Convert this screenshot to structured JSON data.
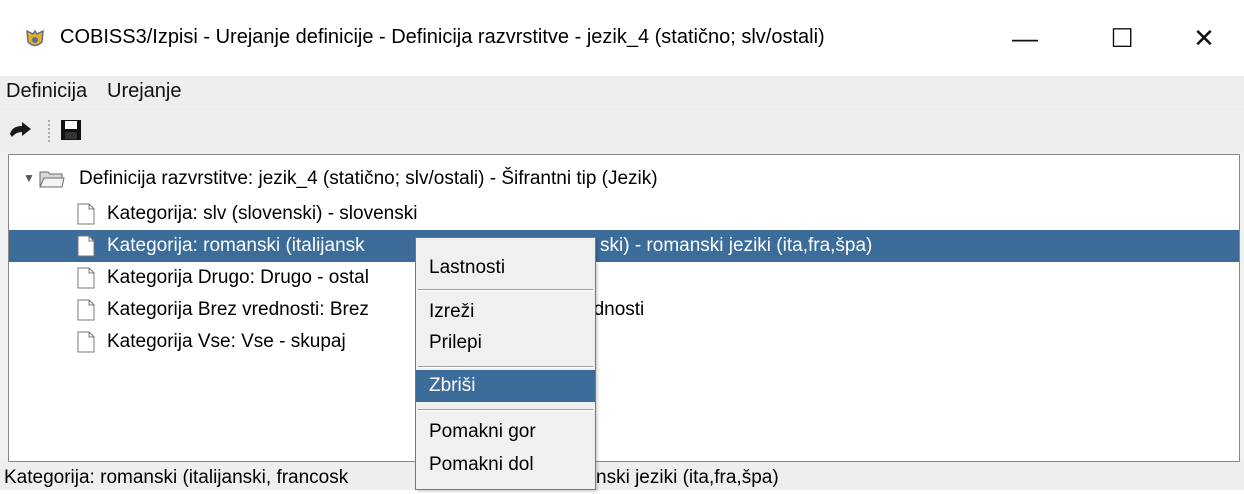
{
  "window": {
    "title": "COBISS3/Izpisi - Urejanje definicije - Definicija razvrstitve - jezik_4 (statično; slv/ostali)",
    "minimize_glyph": "—",
    "maximize_glyph": "☐",
    "close_glyph": "✕"
  },
  "menubar": {
    "items": [
      {
        "label": "Definicija"
      },
      {
        "label": "Urejanje"
      }
    ]
  },
  "toolbar": {
    "buttons": [
      {
        "icon": "back-arrow-icon"
      },
      {
        "icon": "save-disk-icon"
      }
    ]
  },
  "tree": {
    "root": {
      "label": "Definicija razvrstitve: jezik_4 (statično; slv/ostali) - Šifrantni tip (Jezik)",
      "expanded": true,
      "icon": "folder-open-icon"
    },
    "children": [
      {
        "label": "Kategorija: slv (slovenski) - slovenski",
        "selected": false
      },
      {
        "label": "Kategorija: romanski (italijansk",
        "label_tail": "ski) - romanski jeziki (ita,fra,špa)",
        "selected": true
      },
      {
        "label": "Kategorija Drugo: Drugo - ostal",
        "selected": false
      },
      {
        "label": "Kategorija Brez vrednosti: Brez ",
        "label_tail": "ednosti",
        "selected": false
      },
      {
        "label": "Kategorija Vse: Vse - skupaj",
        "selected": false
      }
    ]
  },
  "statusbar": {
    "text_left": "Kategorija: romanski (italijanski, francosk",
    "text_right": "nski jeziki (ita,fra,špa)"
  },
  "context_menu": {
    "items": [
      {
        "label": "Lastnosti"
      },
      {
        "label": "Izreži"
      },
      {
        "label": "Prilepi"
      },
      {
        "label": "Zbriši",
        "active": true
      },
      {
        "label": "Pomakni gor"
      },
      {
        "label": "Pomakni dol"
      }
    ]
  },
  "colors": {
    "selection": "#3b6c9a",
    "titlebar": "#ffffff",
    "chrome": "#eeeeee"
  }
}
